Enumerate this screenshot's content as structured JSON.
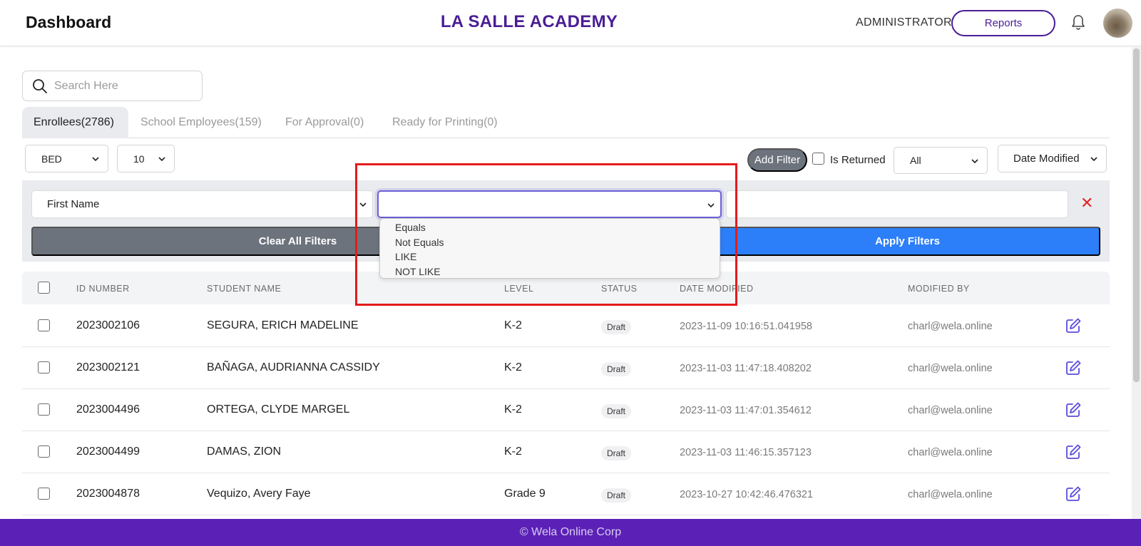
{
  "header": {
    "title": "Dashboard",
    "school": "LA SALLE ACADEMY",
    "role": "ADMINISTRATOR",
    "reports_label": "Reports"
  },
  "search": {
    "placeholder": "Search Here"
  },
  "tabs": [
    {
      "label": "Enrollees(2786)",
      "active": true
    },
    {
      "label": "School Employees(159)",
      "active": false
    },
    {
      "label": "For Approval(0)",
      "active": false
    },
    {
      "label": "Ready for Printing(0)",
      "active": false
    }
  ],
  "controls": {
    "department": "BED",
    "page_size": "10",
    "add_filter_label": "Add Filter",
    "is_returned_label": "Is Returned",
    "status_select": "All",
    "sort_select": "Date Modified"
  },
  "filter": {
    "field": "First Name",
    "operator": "",
    "value": "",
    "remove_symbol": "✕",
    "clear_label": "Clear All Filters",
    "apply_label": "Apply Filters",
    "operator_options": [
      "Equals",
      "Not Equals",
      "LIKE",
      "NOT LIKE"
    ]
  },
  "table": {
    "headers": {
      "id": "ID NUMBER",
      "name": "STUDENT NAME",
      "level": "LEVEL",
      "status": "STATUS",
      "date": "DATE MODIFIED",
      "by": "MODIFIED BY"
    },
    "rows": [
      {
        "id": "2023002106",
        "name": "SEGURA, ERICH MADELINE",
        "level": "K-2",
        "status": "Draft",
        "date": "2023-11-09 10:16:51.041958",
        "by": "charl@wela.online"
      },
      {
        "id": "2023002121",
        "name": "BAÑAGA, AUDRIANNA CASSIDY",
        "level": "K-2",
        "status": "Draft",
        "date": "2023-11-03 11:47:18.408202",
        "by": "charl@wela.online"
      },
      {
        "id": "2023004496",
        "name": "ORTEGA, CLYDE MARGEL",
        "level": "K-2",
        "status": "Draft",
        "date": "2023-11-03 11:47:01.354612",
        "by": "charl@wela.online"
      },
      {
        "id": "2023004499",
        "name": "DAMAS, ZION",
        "level": "K-2",
        "status": "Draft",
        "date": "2023-11-03 11:46:15.357123",
        "by": "charl@wela.online"
      },
      {
        "id": "2023004878",
        "name": "Vequizo, Avery Faye",
        "level": "Grade 9",
        "status": "Draft",
        "date": "2023-10-27 10:42:46.476321",
        "by": "charl@wela.online"
      }
    ]
  },
  "footer": {
    "text": "© Wela Online Corp"
  },
  "colors": {
    "brand_purple": "#4a1d96",
    "footer_purple": "#5b21b6",
    "apply_blue": "#2d7ff9",
    "clear_gray": "#6c737d",
    "highlight_red": "#e31b1b"
  },
  "icons": [
    "search-icon",
    "bell-icon",
    "chevron-down-icon",
    "close-icon",
    "edit-icon",
    "checkbox-icon"
  ]
}
